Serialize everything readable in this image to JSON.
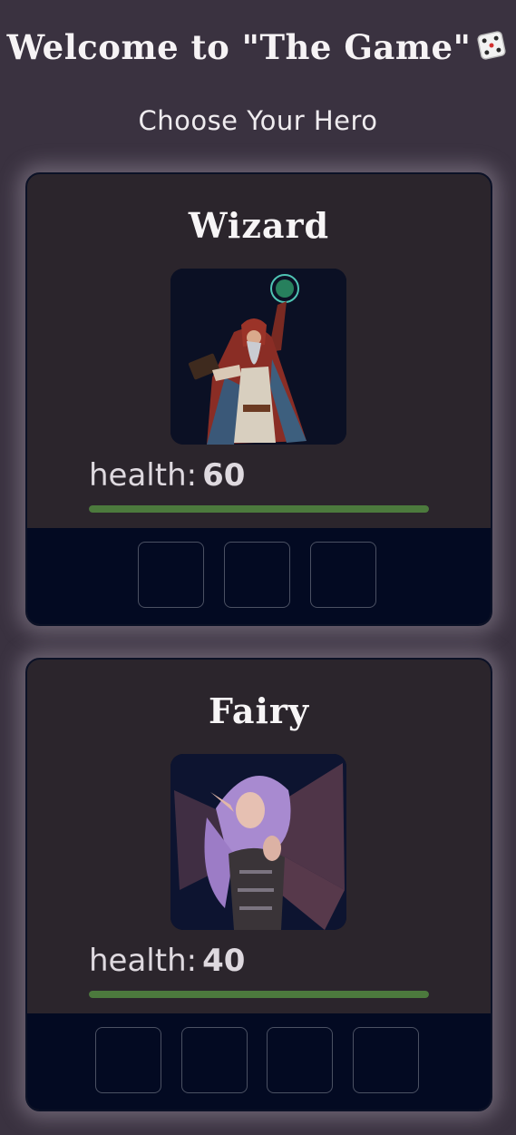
{
  "header": {
    "title": "Welcome to \"The Game\"",
    "title_icon": "dice-icon",
    "subtitle": "Choose Your Hero"
  },
  "heroes": [
    {
      "name": "Wizard",
      "portrait_icon": "wizard-portrait",
      "health_label": "health:",
      "health": "60",
      "health_fraction": 1.0,
      "slot_count": 3
    },
    {
      "name": "Fairy",
      "portrait_icon": "fairy-portrait",
      "health_label": "health:",
      "health": "40",
      "health_fraction": 1.0,
      "slot_count": 4
    }
  ],
  "colors": {
    "background": "#3a3240",
    "card": "#2b252c",
    "tray": "#030a22",
    "health_bar": "#4c7a3d"
  }
}
